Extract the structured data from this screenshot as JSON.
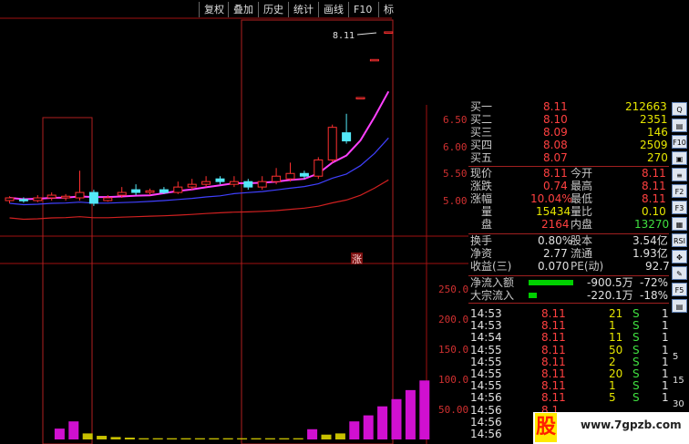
{
  "toolbar": {
    "items": [
      "复权",
      "叠加",
      "历史",
      "统计",
      "画线",
      "F10",
      "标"
    ]
  },
  "chart": {
    "last_price_label": "8.11",
    "price_axis": [
      "6.50",
      "6.00",
      "5.50",
      "5.00"
    ],
    "volume_axis": [
      "250.0",
      "200.0",
      "150.0",
      "100.0",
      "50.00"
    ],
    "limit_up_marker": "涨",
    "candles": [
      {
        "o": 5.0,
        "c": 5.05,
        "h": 5.08,
        "l": 4.95,
        "up": true
      },
      {
        "o": 5.02,
        "c": 5.0,
        "h": 5.06,
        "l": 4.96,
        "up": false
      },
      {
        "o": 5.0,
        "c": 5.05,
        "h": 5.1,
        "l": 4.97,
        "up": true
      },
      {
        "o": 5.05,
        "c": 5.1,
        "h": 5.15,
        "l": 5.0,
        "up": true
      },
      {
        "o": 5.05,
        "c": 5.08,
        "h": 5.12,
        "l": 5.0,
        "up": true
      },
      {
        "o": 5.05,
        "c": 5.15,
        "h": 5.55,
        "l": 5.0,
        "up": true
      },
      {
        "o": 5.15,
        "c": 4.95,
        "h": 5.2,
        "l": 4.9,
        "up": false
      },
      {
        "o": 5.0,
        "c": 5.05,
        "h": 5.1,
        "l": 4.98,
        "up": true
      },
      {
        "o": 5.1,
        "c": 5.15,
        "h": 5.25,
        "l": 5.05,
        "up": true
      },
      {
        "o": 5.2,
        "c": 5.15,
        "h": 5.3,
        "l": 5.1,
        "up": false
      },
      {
        "o": 5.15,
        "c": 5.18,
        "h": 5.22,
        "l": 5.1,
        "up": true
      },
      {
        "o": 5.2,
        "c": 5.15,
        "h": 5.25,
        "l": 5.12,
        "up": false
      },
      {
        "o": 5.15,
        "c": 5.25,
        "h": 5.35,
        "l": 5.12,
        "up": true
      },
      {
        "o": 5.25,
        "c": 5.3,
        "h": 5.4,
        "l": 5.2,
        "up": true
      },
      {
        "o": 5.3,
        "c": 5.35,
        "h": 5.45,
        "l": 5.25,
        "up": true
      },
      {
        "o": 5.4,
        "c": 5.35,
        "h": 5.45,
        "l": 5.3,
        "up": false
      },
      {
        "o": 5.3,
        "c": 5.35,
        "h": 5.45,
        "l": 5.25,
        "up": true
      },
      {
        "o": 5.35,
        "c": 5.25,
        "h": 5.4,
        "l": 5.2,
        "up": false
      },
      {
        "o": 5.25,
        "c": 5.35,
        "h": 5.45,
        "l": 5.2,
        "up": true
      },
      {
        "o": 5.35,
        "c": 5.45,
        "h": 5.6,
        "l": 5.3,
        "up": true
      },
      {
        "o": 5.4,
        "c": 5.5,
        "h": 5.7,
        "l": 5.35,
        "up": true
      },
      {
        "o": 5.5,
        "c": 5.45,
        "h": 5.55,
        "l": 5.4,
        "up": false
      },
      {
        "o": 5.45,
        "c": 5.75,
        "h": 5.8,
        "l": 5.4,
        "up": true
      },
      {
        "o": 5.75,
        "c": 6.35,
        "h": 6.4,
        "l": 5.7,
        "up": true
      },
      {
        "o": 6.25,
        "c": 6.1,
        "h": 6.6,
        "l": 6.05,
        "up": false
      },
      {
        "o": 6.9,
        "c": 6.9,
        "h": 6.9,
        "l": 6.9,
        "up": true
      },
      {
        "o": 7.6,
        "c": 7.6,
        "h": 7.6,
        "l": 7.6,
        "up": true
      },
      {
        "o": 8.11,
        "c": 8.11,
        "h": 8.11,
        "l": 8.11,
        "up": true
      }
    ],
    "volumes": [
      {
        "v": 18,
        "c": "m"
      },
      {
        "v": 30,
        "c": "m"
      },
      {
        "v": 10,
        "c": "y"
      },
      {
        "v": 6,
        "c": "y"
      },
      {
        "v": 4,
        "c": "y"
      },
      {
        "v": 3,
        "c": "y"
      },
      {
        "v": 2,
        "c": "y"
      },
      {
        "v": 2,
        "c": "y"
      },
      {
        "v": 2,
        "c": "y"
      },
      {
        "v": 2,
        "c": "y"
      },
      {
        "v": 2,
        "c": "y"
      },
      {
        "v": 2,
        "c": "y"
      },
      {
        "v": 2,
        "c": "y"
      },
      {
        "v": 2,
        "c": "y"
      },
      {
        "v": 2,
        "c": "y"
      },
      {
        "v": 2,
        "c": "y"
      },
      {
        "v": 2,
        "c": "y"
      },
      {
        "v": 2,
        "c": "y"
      },
      {
        "v": 17,
        "c": "m"
      },
      {
        "v": 8,
        "c": "y"
      },
      {
        "v": 10,
        "c": "y"
      },
      {
        "v": 30,
        "c": "m"
      },
      {
        "v": 40,
        "c": "m"
      },
      {
        "v": 55,
        "c": "m"
      },
      {
        "v": 67,
        "c": "m"
      },
      {
        "v": 82,
        "c": "m"
      },
      {
        "v": 98,
        "c": "m"
      }
    ]
  },
  "quote": {
    "asks": [
      {
        "label": "买一",
        "price": "8.11",
        "vol": "212663"
      },
      {
        "label": "买二",
        "price": "8.10",
        "vol": "2351"
      },
      {
        "label": "买三",
        "price": "8.09",
        "vol": "146"
      },
      {
        "label": "买四",
        "price": "8.08",
        "vol": "2509"
      },
      {
        "label": "买五",
        "price": "8.07",
        "vol": "270"
      }
    ],
    "stats": [
      {
        "l1": "现价",
        "v1": "8.11",
        "l2": "今开",
        "v2": "8.11"
      },
      {
        "l1": "涨跌",
        "v1": "0.74",
        "l2": "最高",
        "v2": "8.11"
      },
      {
        "l1": "涨幅",
        "v1": "10.04%",
        "l2": "最低",
        "v2": "8.11"
      },
      {
        "l1": "量",
        "v1": "15434",
        "l2": "量比",
        "v2": "0.10"
      },
      {
        "l1": "盘",
        "v1": "2164",
        "l2": "内盘",
        "v2": "13270"
      }
    ],
    "fund": [
      {
        "l1": "换手",
        "v1": "0.80%",
        "l2": "股本",
        "v2": "3.54亿"
      },
      {
        "l1": "净资",
        "v1": "2.77",
        "l2": "流通",
        "v2": "1.93亿"
      },
      {
        "l1": "收益(三)",
        "v1": "0.070",
        "l2": "PE(动)",
        "v2": "92.7"
      }
    ],
    "flows": [
      {
        "label": "净流入额",
        "value": "-900.5万",
        "pct": "-72%",
        "bar": 0.95
      },
      {
        "label": "大宗流入",
        "value": "-220.1万",
        "pct": "-18%",
        "bar": 0.18
      }
    ],
    "ticks": [
      {
        "t": "14:53",
        "p": "8.11",
        "v": "21",
        "s": "S",
        "n": "1"
      },
      {
        "t": "14:53",
        "p": "8.11",
        "v": "1",
        "s": "S",
        "n": "1"
      },
      {
        "t": "14:54",
        "p": "8.11",
        "v": "11",
        "s": "S",
        "n": "1"
      },
      {
        "t": "14:55",
        "p": "8.11",
        "v": "50",
        "s": "S",
        "n": "1"
      },
      {
        "t": "14:55",
        "p": "8.11",
        "v": "2",
        "s": "S",
        "n": "1"
      },
      {
        "t": "14:55",
        "p": "8.11",
        "v": "20",
        "s": "S",
        "n": "1"
      },
      {
        "t": "14:55",
        "p": "8.11",
        "v": "1",
        "s": "S",
        "n": "1"
      },
      {
        "t": "14:56",
        "p": "8.11",
        "v": "5",
        "s": "S",
        "n": "1"
      },
      {
        "t": "14:56",
        "p": "8.1",
        "v": "",
        "s": "",
        "n": ""
      },
      {
        "t": "14:56",
        "p": "",
        "v": "",
        "s": "",
        "n": ""
      },
      {
        "t": "14:56",
        "p": "",
        "v": "",
        "s": "",
        "n": ""
      }
    ]
  },
  "sidebar": {
    "icons": [
      {
        "name": "zoom-icon",
        "label": "Q"
      },
      {
        "name": "chart-icon",
        "label": "▤"
      },
      {
        "name": "f10-icon",
        "label": "F10"
      },
      {
        "name": "fund-icon",
        "label": "▣"
      },
      {
        "name": "list-icon",
        "label": "≡"
      },
      {
        "name": "f2-icon",
        "label": "F2"
      },
      {
        "name": "f3-icon",
        "label": "F3"
      },
      {
        "name": "grid-icon",
        "label": "▦"
      },
      {
        "name": "rsi-icon",
        "label": "RSI"
      },
      {
        "name": "move-icon",
        "label": "✥"
      },
      {
        "name": "pen-icon",
        "label": "✎"
      },
      {
        "name": "f5-icon",
        "label": "F5"
      },
      {
        "name": "doc-icon",
        "label": "▤"
      }
    ],
    "page_numbers": [
      "5",
      "15",
      "30"
    ]
  },
  "watermark": {
    "logo": "股",
    "url": "www.7gpzb.com"
  },
  "colors": {
    "up": "#ff3030",
    "down": "#54e8f8",
    "ma5": "#ff40ff",
    "ma10": "#4040ff",
    "ma20": "#d02020",
    "grid": "#a01010"
  }
}
